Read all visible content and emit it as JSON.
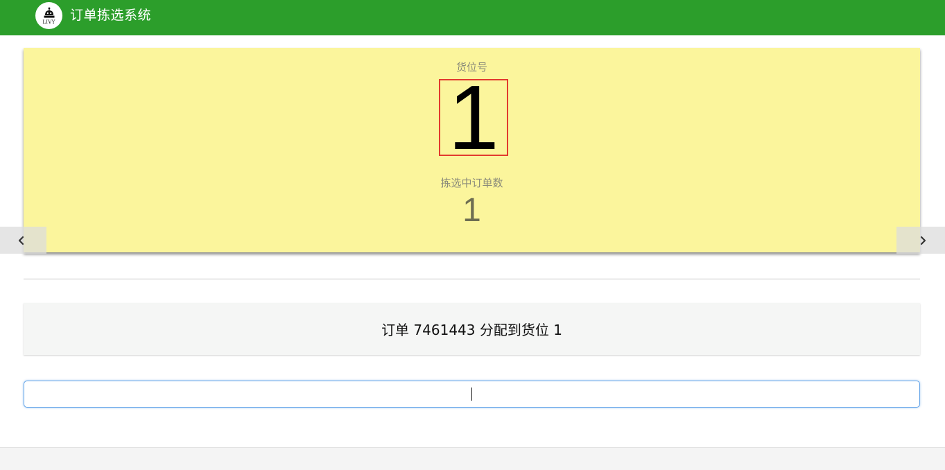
{
  "app": {
    "title": "订单拣选系统",
    "logo_text": "LIVY",
    "theme_color": "#2c9e2b"
  },
  "slot_panel": {
    "slot_label": "货位号",
    "slot_number": "1",
    "picking_count_label": "拣选中订单数",
    "picking_count": "1",
    "background_color": "#fbf59c"
  },
  "carousel": {
    "prev_icon": "chevron-left-icon",
    "next_icon": "chevron-right-icon"
  },
  "message": {
    "text": "订单 7461443 分配到货位 1"
  },
  "scan_input": {
    "value": "",
    "placeholder": ""
  }
}
